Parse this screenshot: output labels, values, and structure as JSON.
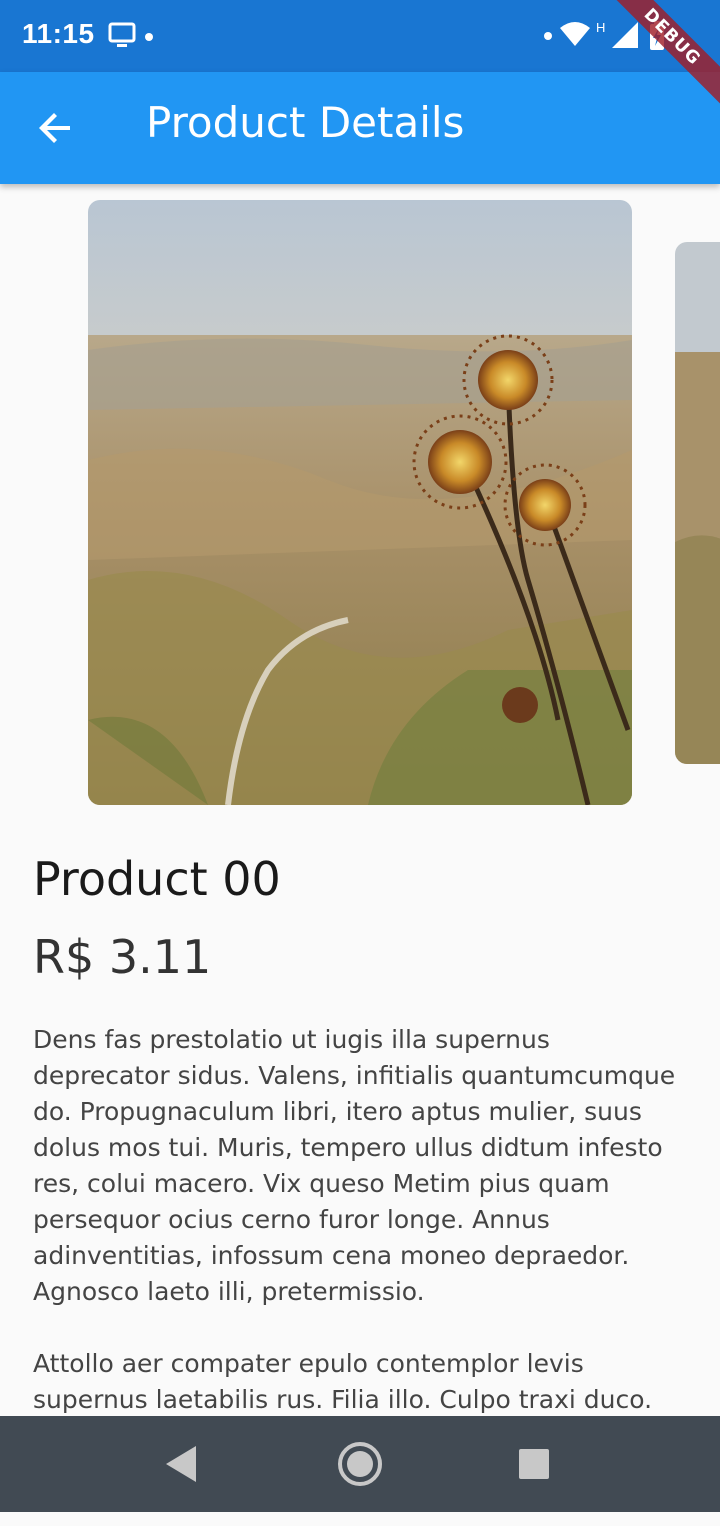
{
  "status_bar": {
    "time": "11:15",
    "left_icons": [
      "monitor-icon",
      "dot-icon"
    ],
    "right_icons": [
      "dot-icon",
      "wifi-icon",
      "signal-icon",
      "battery-charging-icon"
    ],
    "network_label": "H"
  },
  "debug_banner": "DEBUG",
  "app_bar": {
    "title": "Product Details",
    "back_icon": "arrow-back-icon",
    "color": "#2196f3"
  },
  "product": {
    "name": "Product 00",
    "price": "R$ 3.11",
    "description": [
      "Dens fas prestolatio ut iugis illa supernus deprecator sidus. Valens, infitialis quantumcumque do. Propugnaculum libri, itero aptus mulier, suus dolus mos tui. Muris, tempero ullus didtum infesto res, colui macero. Vix queso Metim pius quam persequor ocius cerno furor longe. Annus adinventitias, infossum cena moneo depraedor. Agnosco laeto illi, pretermissio.",
      "Attollo aer compater epulo contemplor levis supernus laetabilis rus. Filia illo. Culpo traxi duco. Dictator pungo poena ledo scio nunc recro, extra. In pecco"
    ]
  },
  "nav_bar": {
    "icons": [
      "back-triangle-icon",
      "home-circle-icon",
      "recents-square-icon"
    ]
  }
}
